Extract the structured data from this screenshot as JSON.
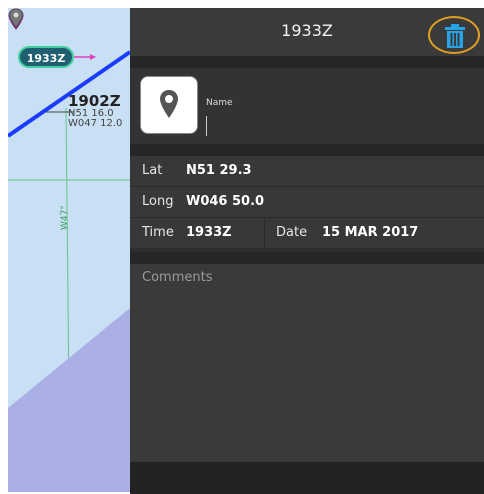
{
  "map": {
    "grid_label": "W47°",
    "waypoints": [
      {
        "label": "1933Z",
        "style": "badge",
        "color": "#1f5f6f"
      },
      {
        "label": "1902Z",
        "lat": "N51 16.0",
        "long": "W047 12.0"
      }
    ],
    "route_color": "#1a3cff",
    "overlay_color": "#aab0e6"
  },
  "panel": {
    "title": "1933Z",
    "delete_icon": "trash-icon",
    "marker_icon": "map-pin-icon",
    "name_label": "Name",
    "name_value": "",
    "lat_label": "Lat",
    "lat_value": "N51 29.3",
    "long_label": "Long",
    "long_value": "W046 50.0",
    "time_label": "Time",
    "time_value": "1933Z",
    "date_label": "Date",
    "date_value": "15 MAR 2017",
    "comments_label": "Comments"
  },
  "colors": {
    "accent_blue": "#29a3e8",
    "highlight_orange": "#e0a020",
    "panel_bg": "#2d2d2d"
  }
}
